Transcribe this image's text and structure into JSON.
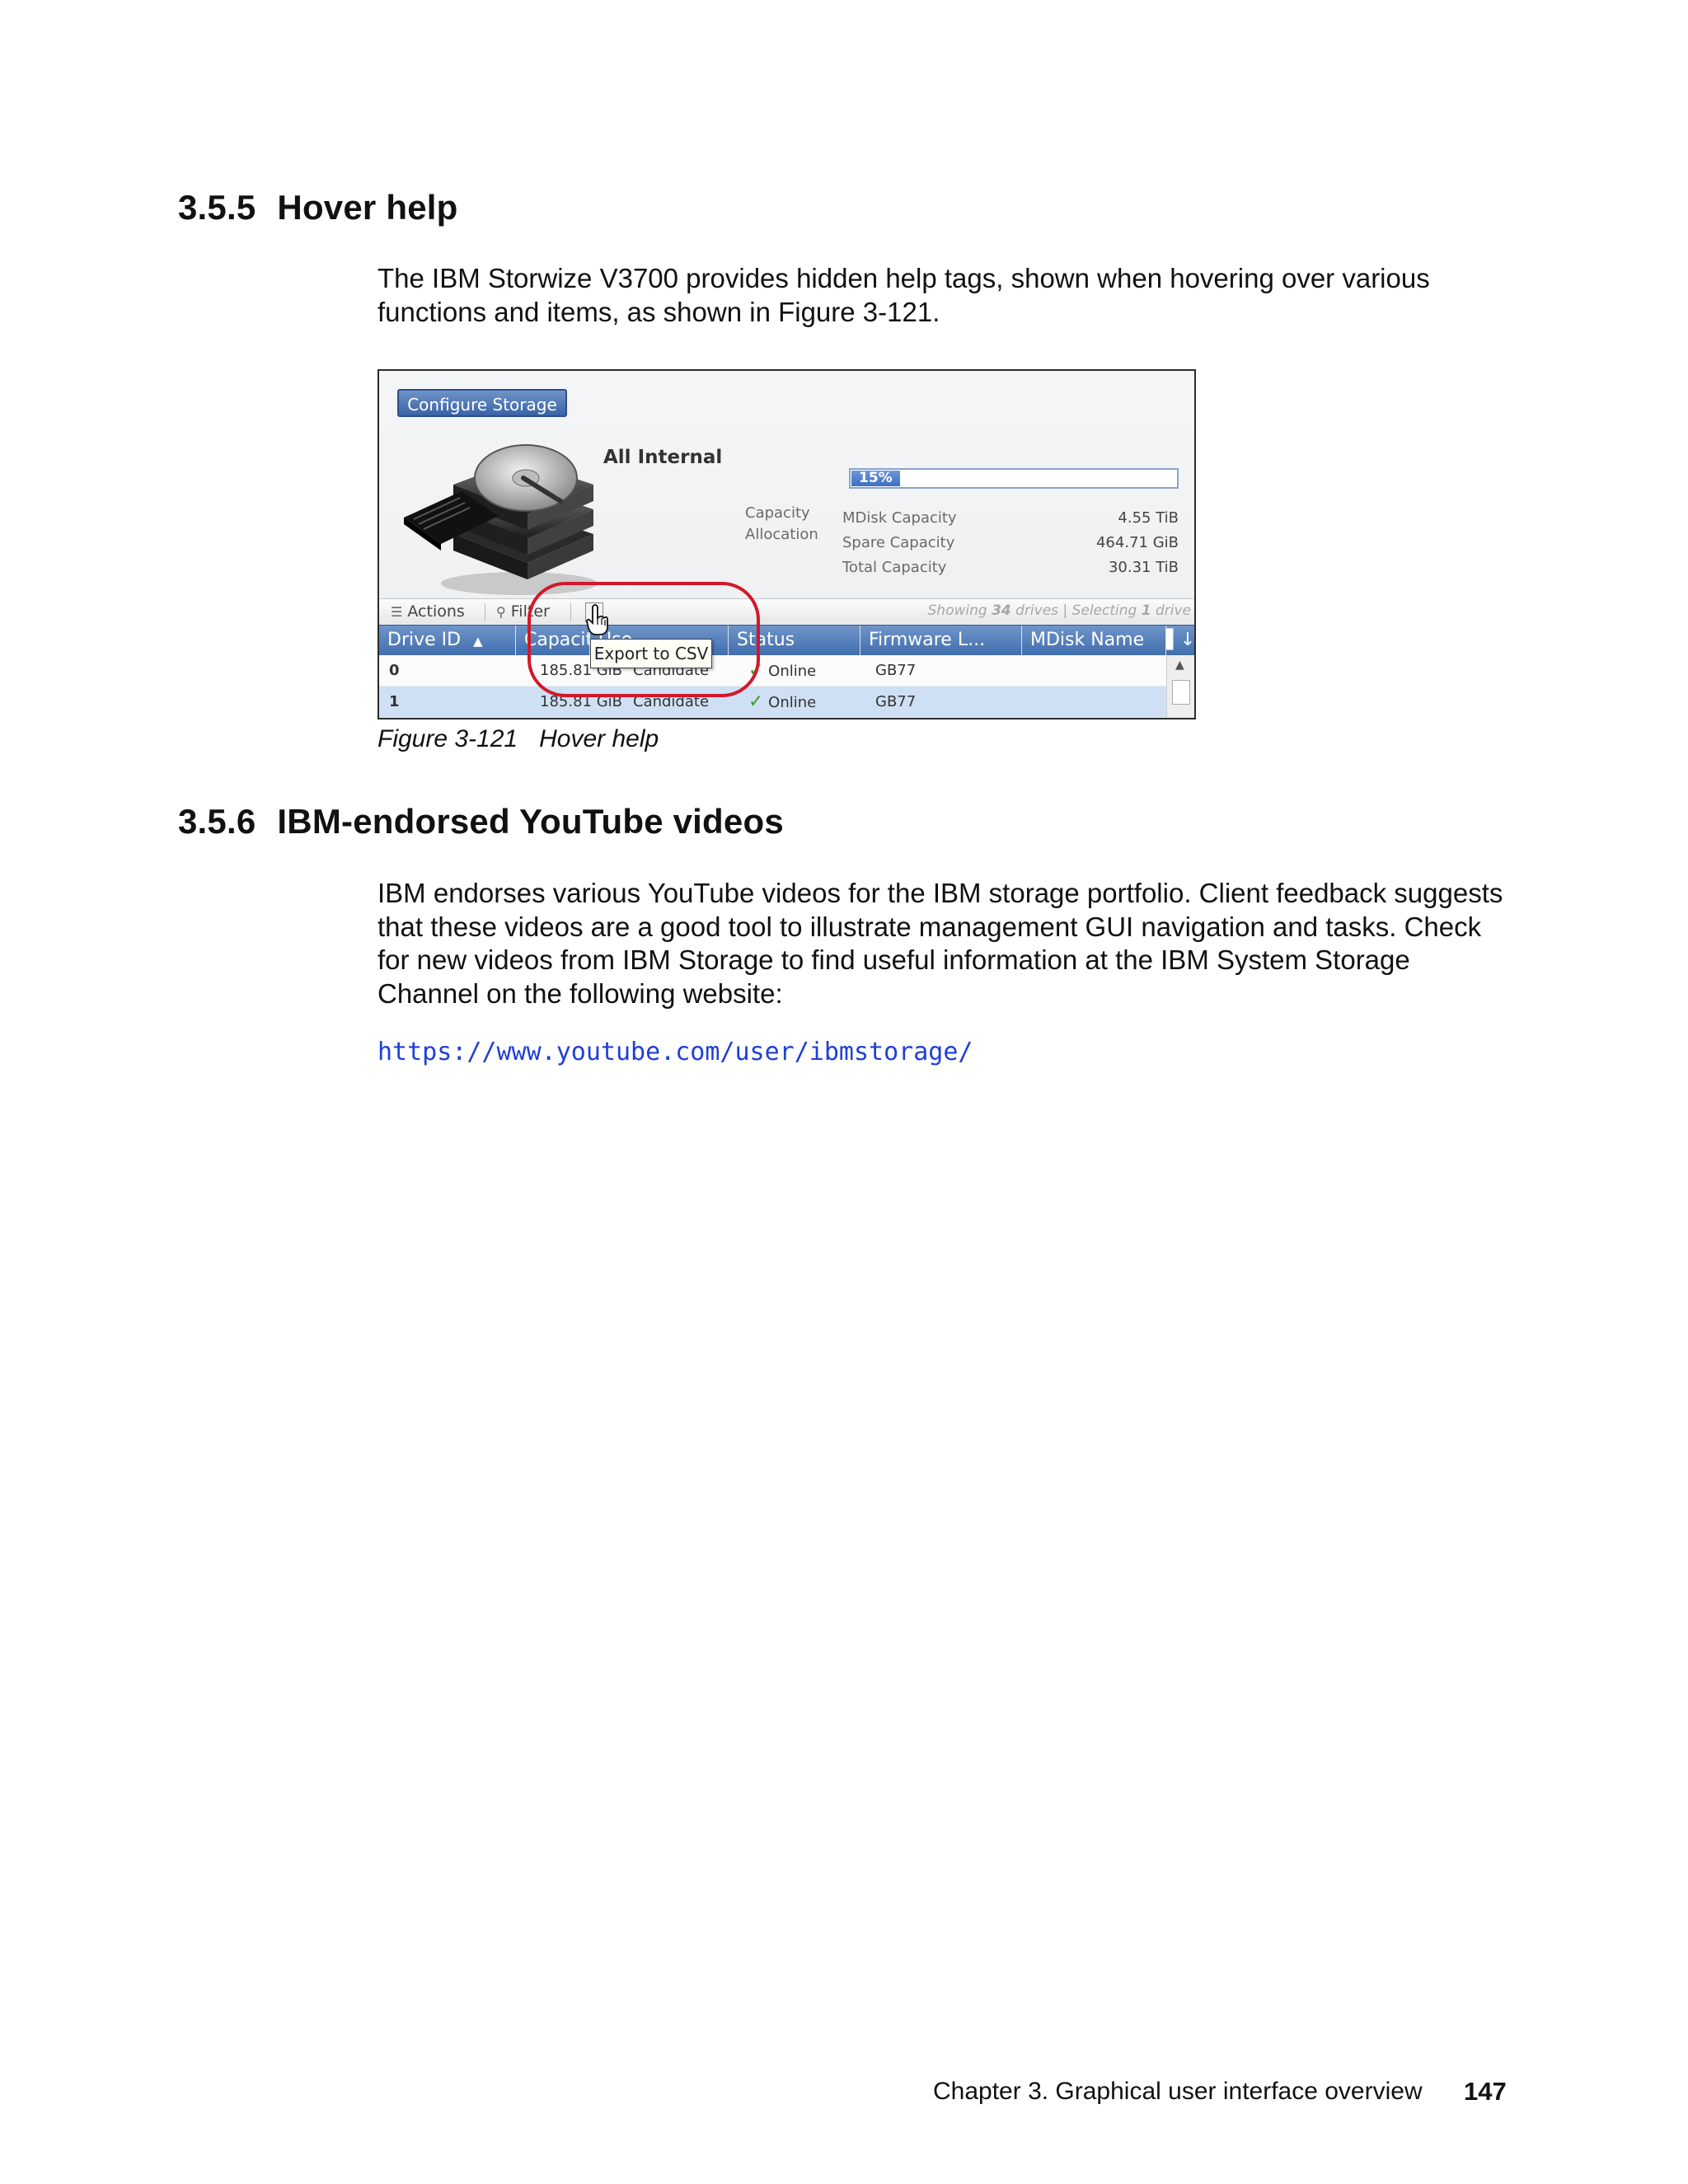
{
  "section1": {
    "number": "3.5.5",
    "title": "Hover help",
    "para": "The IBM Storwize V3700 provides hidden help tags, shown when hovering over various functions and items, as shown in Figure 3-121."
  },
  "figure": {
    "configure_button": "Configure Storage",
    "pool_title": "All Internal",
    "capacity_label_1": "Capacity",
    "capacity_label_2": "Allocation",
    "progress_text": "15%",
    "progress_fraction": 0.15,
    "capacity_rows": [
      {
        "label": "MDisk Capacity",
        "value": "4.55 TiB"
      },
      {
        "label": "Spare Capacity",
        "value": "464.71 GiB"
      },
      {
        "label": "Total Capacity",
        "value": "30.31 TiB"
      }
    ],
    "toolbar": {
      "actions": "Actions",
      "filter": "Filter",
      "status_showing": "Showing",
      "status_count": "34",
      "status_drives": "drives | Selecting",
      "status_sel": "1",
      "status_tail": "drive"
    },
    "columns": [
      "Drive ID",
      "Capacity",
      "Use",
      "Status",
      "Firmware L...",
      "MDisk Name"
    ],
    "rows": [
      {
        "id": "0",
        "capacity": "185.81 GiB",
        "use": "Candidate",
        "status": "Online",
        "firmware": "GB77"
      },
      {
        "id": "1",
        "capacity": "185.81 GiB",
        "use": "Candidate",
        "status": "Online",
        "firmware": "GB77"
      }
    ],
    "tooltip": "Export to CSV",
    "caption_num": "Figure 3-121",
    "caption_text": "Hover help",
    "colors": {
      "accent": "#416eae",
      "highlight_ring": "#d2182a",
      "selected_row": "#cfe0f4"
    }
  },
  "section2": {
    "number": "3.5.6",
    "title": "IBM-endorsed YouTube videos",
    "para": "IBM endorses various YouTube videos for the IBM storage portfolio. Client feedback suggests that these videos are a good tool to illustrate management GUI navigation and tasks. Check for new videos from IBM Storage to find useful information at the IBM System Storage Channel on the following website:",
    "url": "https://www.youtube.com/user/ibmstorage/"
  },
  "footer": {
    "chapter": "Chapter 3. Graphical user interface overview",
    "page": "147"
  }
}
